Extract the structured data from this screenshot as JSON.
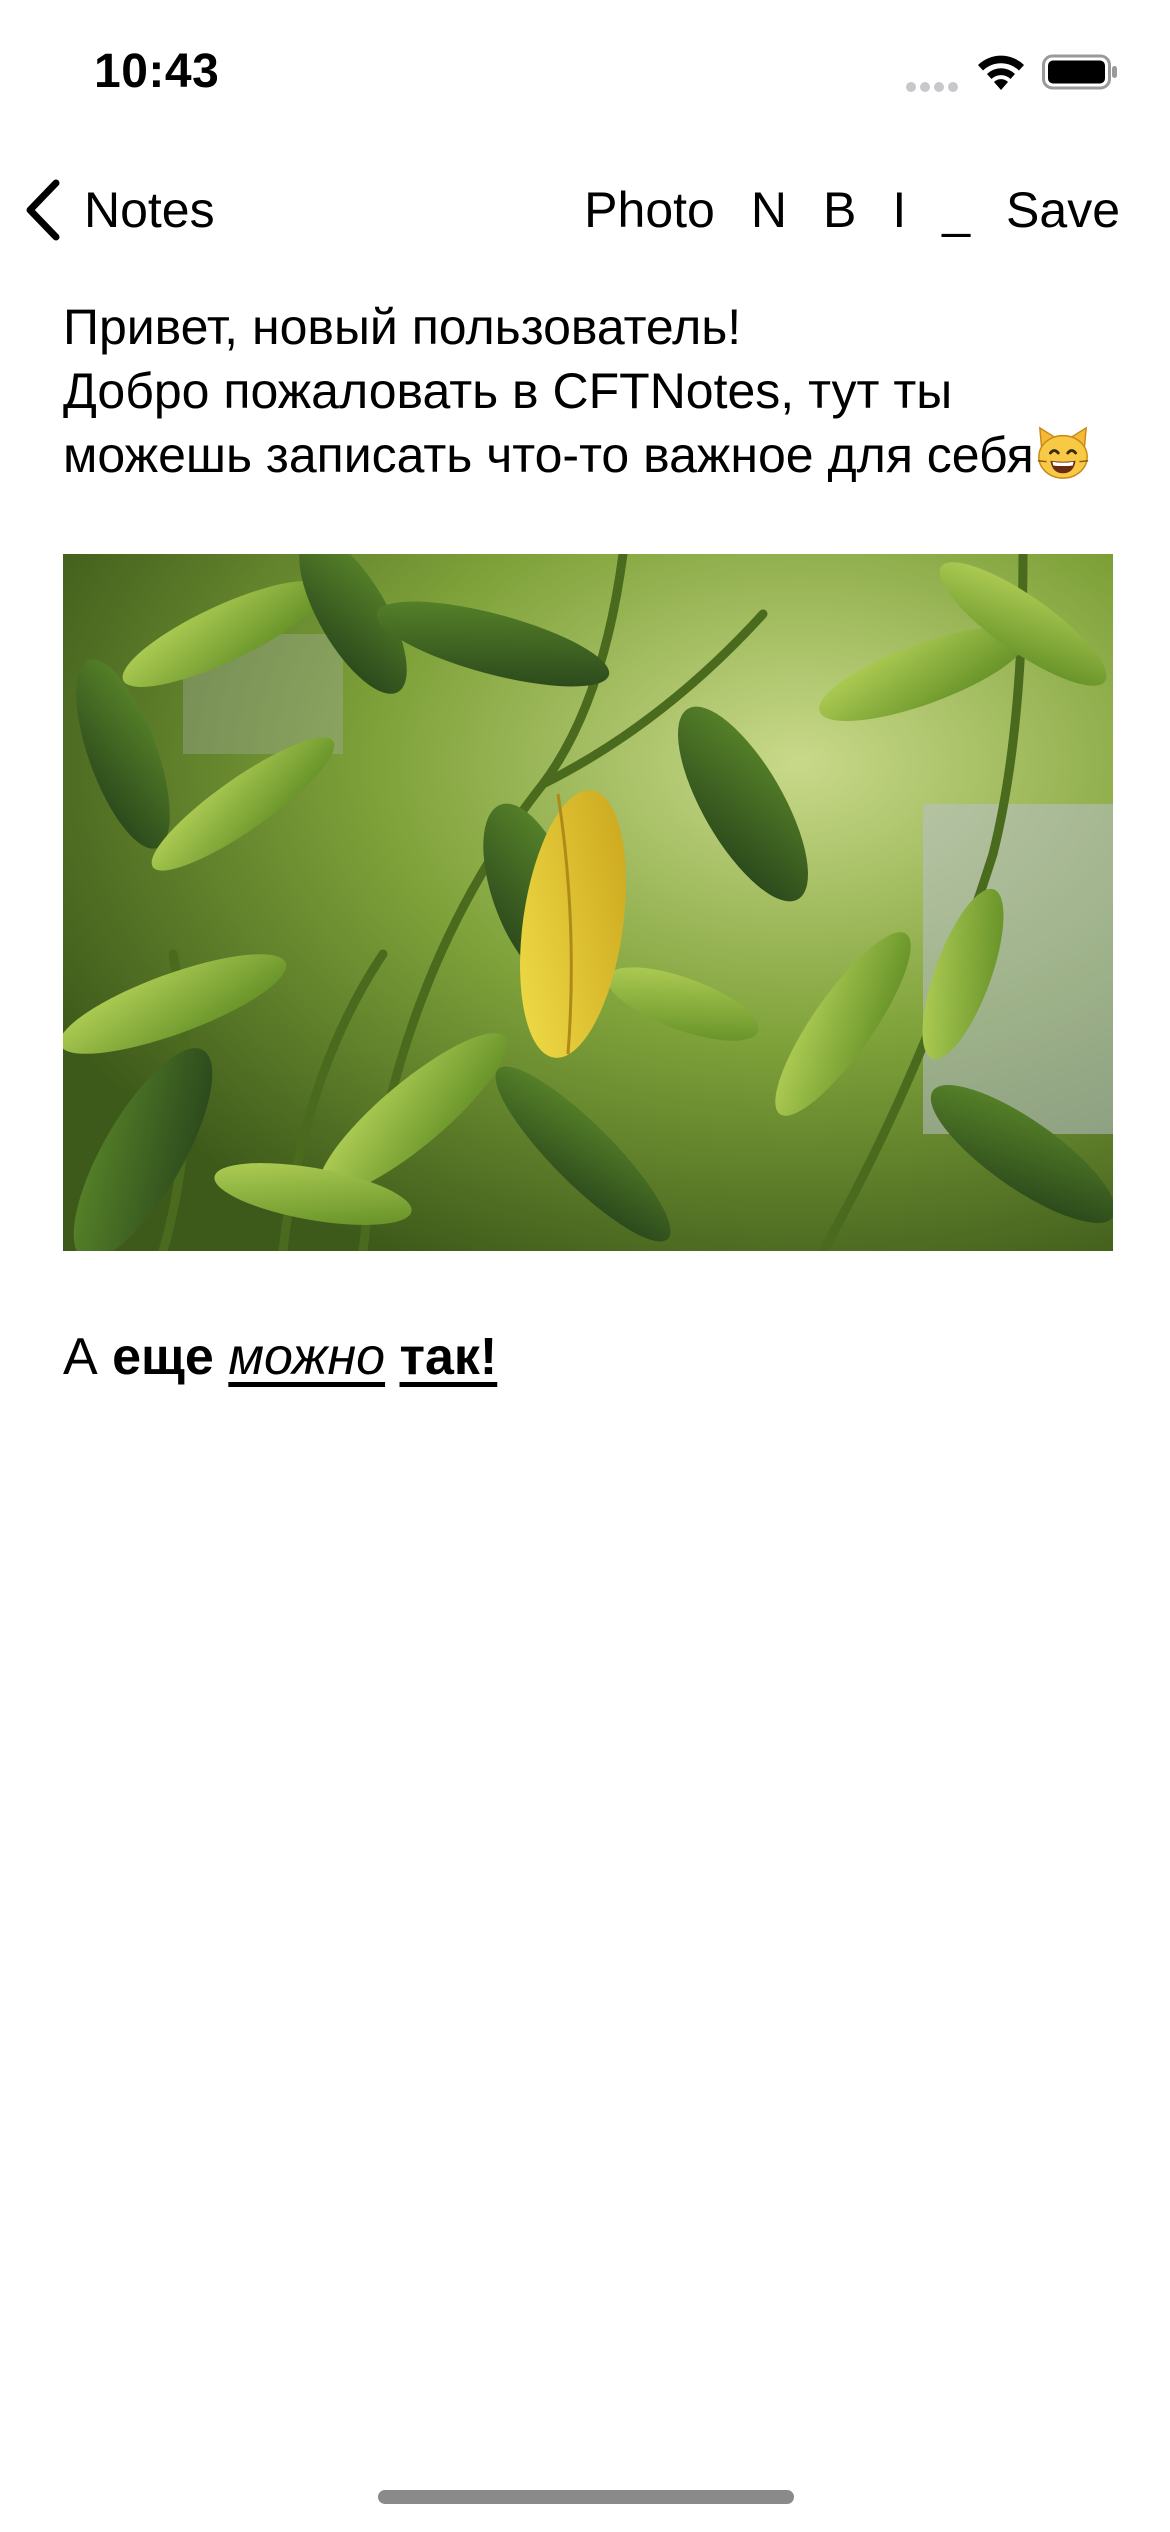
{
  "status_bar": {
    "time": "10:43"
  },
  "nav": {
    "back_label": "Notes",
    "toolbar": {
      "photo_label": "Photo",
      "normal_label": "N",
      "bold_label": "B",
      "italic_label": "I",
      "underline_label": "_",
      "save_label": "Save"
    }
  },
  "note": {
    "lines": [
      "Привет, новый пользователь!",
      "Добро пожаловать в CFTNotes, тут ты можешь записать что-то важное для себя"
    ],
    "emoji": "smiling-cat-face",
    "rich_line": {
      "part1": "А ",
      "part2_bold": "еще",
      "part3": " ",
      "part4_italic_underline": "можно",
      "part5": " ",
      "part6_bold_underline": "так!"
    }
  },
  "colors": {
    "text": "#000000",
    "background": "#ffffff",
    "home_indicator": "#8a8a8a"
  }
}
